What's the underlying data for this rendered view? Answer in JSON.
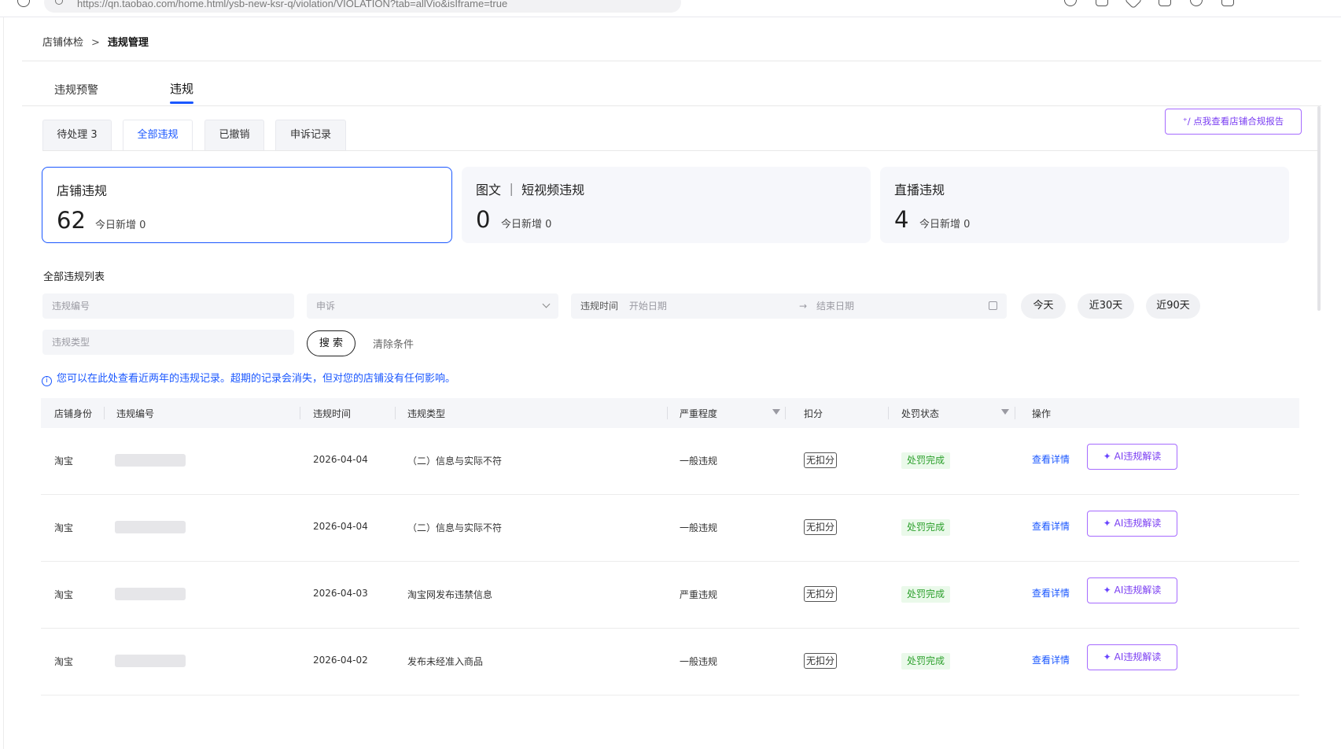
{
  "browser": {
    "url": "https://qn.taobao.com/home.html/ysb-new-ksr-q/violation/VIOLATION?tab=allVio&isIframe=true"
  },
  "breadcrumb": {
    "parent": "店铺体检",
    "separator": ">",
    "current": "违规管理"
  },
  "top_tabs": [
    {
      "label": "违规预警",
      "active": false
    },
    {
      "label": "违规",
      "active": true
    }
  ],
  "sub_tabs": [
    {
      "label": "待处理 3",
      "active": false
    },
    {
      "label": "全部违规",
      "active": true
    },
    {
      "label": "已撤销",
      "active": false
    },
    {
      "label": "申诉记录",
      "active": false
    }
  ],
  "report_button": {
    "label": "点我查看店铺合规报告"
  },
  "stats": [
    {
      "title": "店铺违规",
      "value": "62",
      "new_label": "今日新增 0",
      "active": true
    },
    {
      "title": "图文 ｜ 短视频违规",
      "value": "0",
      "new_label": "今日新增 0",
      "active": false
    },
    {
      "title": "直播违规",
      "value": "4",
      "new_label": "今日新增 0",
      "active": false
    }
  ],
  "list": {
    "title": "全部违规列表"
  },
  "filters": {
    "violation_id_placeholder": "违规编号",
    "appeal_placeholder": "申诉",
    "time_label": "违规时间",
    "start_date_placeholder": "开始日期",
    "date_arrow": "→",
    "end_date_placeholder": "结束日期",
    "violation_type_placeholder": "违规类型",
    "quick_ranges": [
      "今天",
      "近30天",
      "近90天"
    ],
    "search_label": "搜 索",
    "clear_label": "清除条件"
  },
  "notice": {
    "icon": "i",
    "text": "您可以在此处查看近两年的违规记录。超期的记录会消失，但对您的店铺没有任何影响。"
  },
  "table": {
    "headers": {
      "shop_identity": "店铺身份",
      "violation_id": "违规编号",
      "violation_time": "违规时间",
      "violation_type": "违规类型",
      "severity": "严重程度",
      "deduction": "扣分",
      "status": "处罚状态",
      "actions": "操作"
    },
    "rows": [
      {
        "shop": "淘宝",
        "date": "2026-04-04",
        "type": "（二）信息与实际不符",
        "severity": "一般违规",
        "deduction": "无扣分",
        "status": "处罚完成",
        "detail": "查看详情",
        "ai": "AI违规解读"
      },
      {
        "shop": "淘宝",
        "date": "2026-04-04",
        "type": "（二）信息与实际不符",
        "severity": "一般违规",
        "deduction": "无扣分",
        "status": "处罚完成",
        "detail": "查看详情",
        "ai": "AI违规解读"
      },
      {
        "shop": "淘宝",
        "date": "2026-04-03",
        "type": "淘宝网发布违禁信息",
        "severity": "严重违规",
        "deduction": "无扣分",
        "status": "处罚完成",
        "detail": "查看详情",
        "ai": "AI违规解读"
      },
      {
        "shop": "淘宝",
        "date": "2026-04-02",
        "type": "发布未经准入商品",
        "severity": "一般违规",
        "deduction": "无扣分",
        "status": "处罚完成",
        "detail": "查看详情",
        "ai": "AI违规解读"
      }
    ]
  },
  "colors": {
    "accent": "#1a57ff",
    "ai_purple": "#7a3df2",
    "status_green": "#2ca02c",
    "status_green_bg": "#eaf9ea"
  }
}
